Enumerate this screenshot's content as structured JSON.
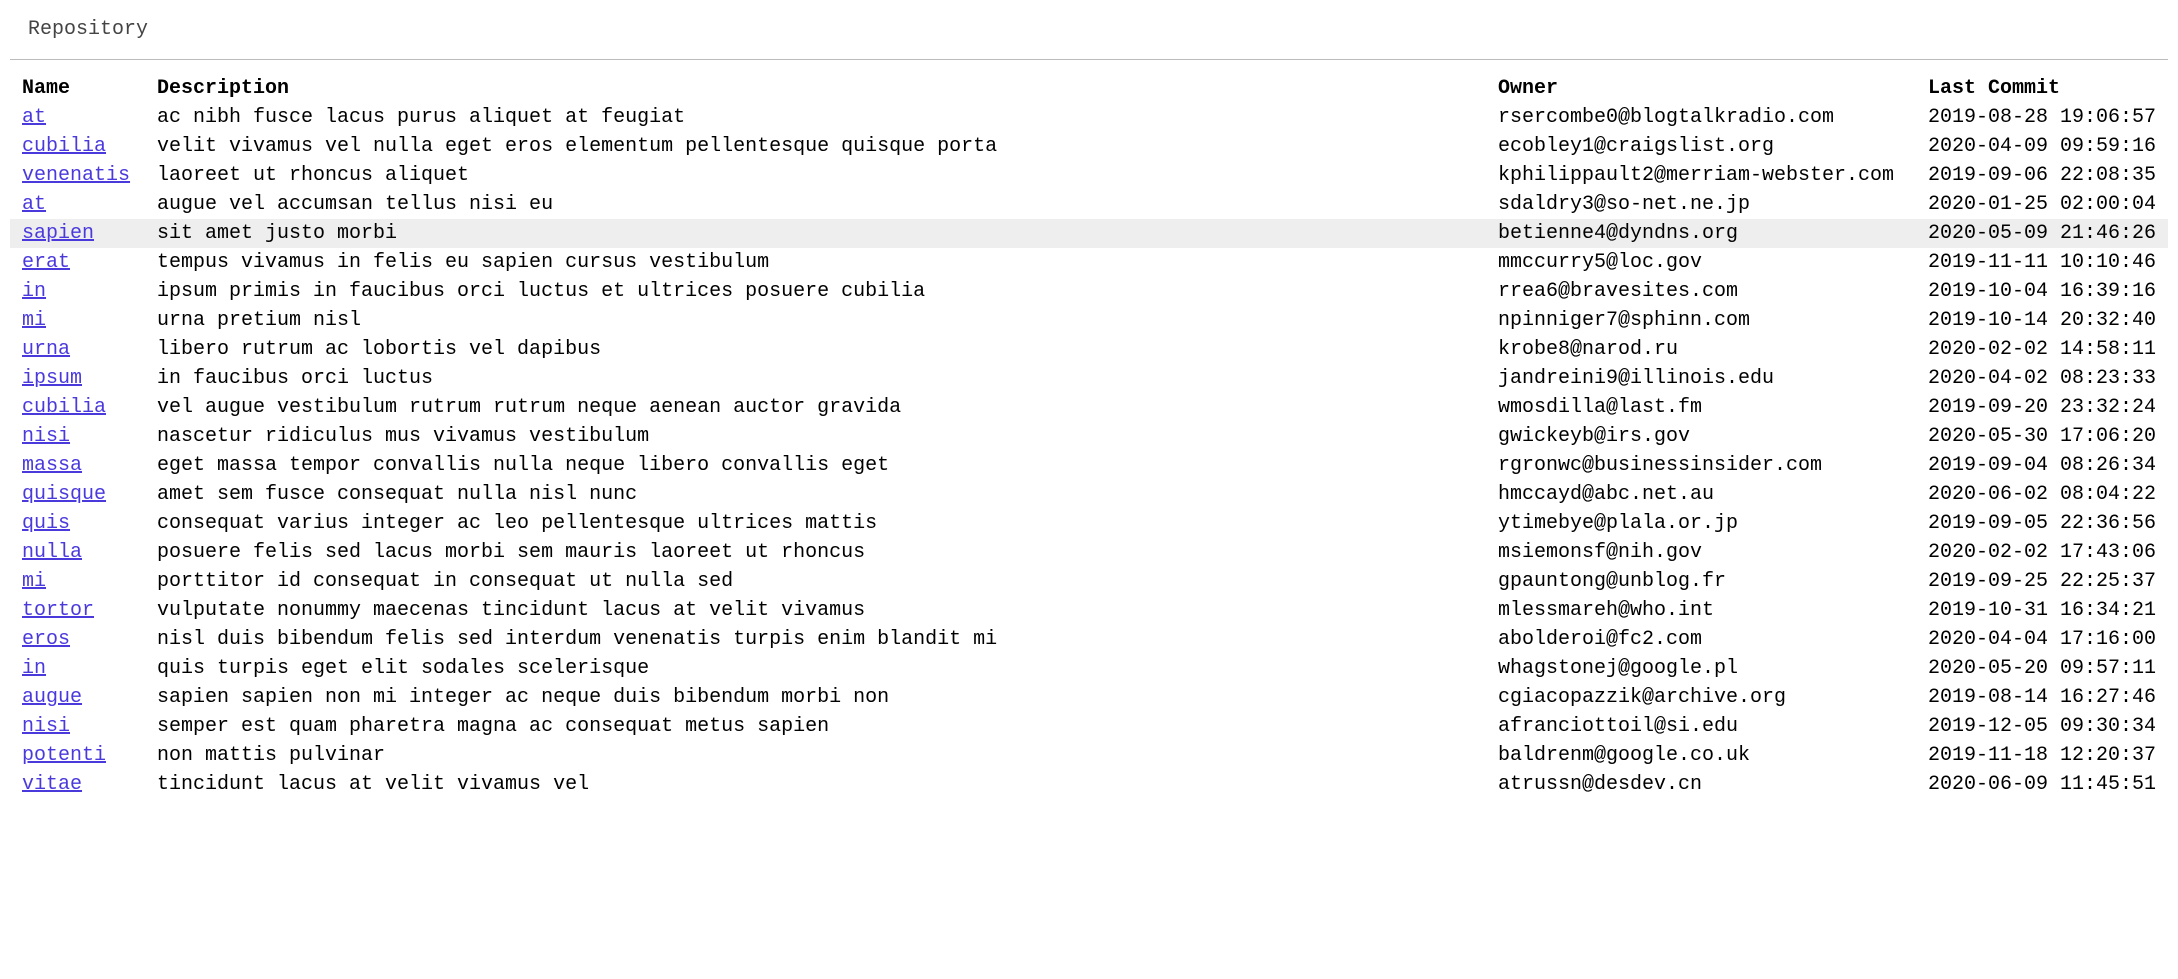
{
  "page_title": "Repository",
  "columns": {
    "name": "Name",
    "description": "Description",
    "owner": "Owner",
    "last_commit": "Last Commit"
  },
  "hovered_row_index": 4,
  "rows": [
    {
      "name": "at",
      "description": "ac nibh fusce lacus purus aliquet at feugiat",
      "owner": "rsercombe0@blogtalkradio.com",
      "last_commit": "2019-08-28 19:06:57"
    },
    {
      "name": "cubilia",
      "description": "velit vivamus vel nulla eget eros elementum pellentesque quisque porta",
      "owner": "ecobley1@craigslist.org",
      "last_commit": "2020-04-09 09:59:16"
    },
    {
      "name": "venenatis",
      "description": "laoreet ut rhoncus aliquet",
      "owner": "kphilippault2@merriam-webster.com",
      "last_commit": "2019-09-06 22:08:35"
    },
    {
      "name": "at",
      "description": "augue vel accumsan tellus nisi eu",
      "owner": "sdaldry3@so-net.ne.jp",
      "last_commit": "2020-01-25 02:00:04"
    },
    {
      "name": "sapien",
      "description": "sit amet justo morbi",
      "owner": "betienne4@dyndns.org",
      "last_commit": "2020-05-09 21:46:26"
    },
    {
      "name": "erat",
      "description": "tempus vivamus in felis eu sapien cursus vestibulum",
      "owner": "mmccurry5@loc.gov",
      "last_commit": "2019-11-11 10:10:46"
    },
    {
      "name": "in",
      "description": "ipsum primis in faucibus orci luctus et ultrices posuere cubilia",
      "owner": "rrea6@bravesites.com",
      "last_commit": "2019-10-04 16:39:16"
    },
    {
      "name": "mi",
      "description": "urna pretium nisl",
      "owner": "npinniger7@sphinn.com",
      "last_commit": "2019-10-14 20:32:40"
    },
    {
      "name": "urna",
      "description": "libero rutrum ac lobortis vel dapibus",
      "owner": "krobe8@narod.ru",
      "last_commit": "2020-02-02 14:58:11"
    },
    {
      "name": "ipsum",
      "description": "in faucibus orci luctus",
      "owner": "jandreini9@illinois.edu",
      "last_commit": "2020-04-02 08:23:33"
    },
    {
      "name": "cubilia",
      "description": "vel augue vestibulum rutrum rutrum neque aenean auctor gravida",
      "owner": "wmosdilla@last.fm",
      "last_commit": "2019-09-20 23:32:24"
    },
    {
      "name": "nisi",
      "description": "nascetur ridiculus mus vivamus vestibulum",
      "owner": "gwickeyb@irs.gov",
      "last_commit": "2020-05-30 17:06:20"
    },
    {
      "name": "massa",
      "description": "eget massa tempor convallis nulla neque libero convallis eget",
      "owner": "rgronwc@businessinsider.com",
      "last_commit": "2019-09-04 08:26:34"
    },
    {
      "name": "quisque",
      "description": "amet sem fusce consequat nulla nisl nunc",
      "owner": "hmccayd@abc.net.au",
      "last_commit": "2020-06-02 08:04:22"
    },
    {
      "name": "quis",
      "description": "consequat varius integer ac leo pellentesque ultrices mattis",
      "owner": "ytimebye@plala.or.jp",
      "last_commit": "2019-09-05 22:36:56"
    },
    {
      "name": "nulla",
      "description": "posuere felis sed lacus morbi sem mauris laoreet ut rhoncus",
      "owner": "msiemonsf@nih.gov",
      "last_commit": "2020-02-02 17:43:06"
    },
    {
      "name": "mi",
      "description": "porttitor id consequat in consequat ut nulla sed",
      "owner": "gpauntong@unblog.fr",
      "last_commit": "2019-09-25 22:25:37"
    },
    {
      "name": "tortor",
      "description": "vulputate nonummy maecenas tincidunt lacus at velit vivamus",
      "owner": "mlessmareh@who.int",
      "last_commit": "2019-10-31 16:34:21"
    },
    {
      "name": "eros",
      "description": "nisl duis bibendum felis sed interdum venenatis turpis enim blandit mi",
      "owner": "abolderoi@fc2.com",
      "last_commit": "2020-04-04 17:16:00"
    },
    {
      "name": "in",
      "description": "quis turpis eget elit sodales scelerisque",
      "owner": "whagstonej@google.pl",
      "last_commit": "2020-05-20 09:57:11"
    },
    {
      "name": "augue",
      "description": "sapien sapien non mi integer ac neque duis bibendum morbi non",
      "owner": "cgiacopazzik@archive.org",
      "last_commit": "2019-08-14 16:27:46"
    },
    {
      "name": "nisi",
      "description": "semper est quam pharetra magna ac consequat metus sapien",
      "owner": "afranciottoil@si.edu",
      "last_commit": "2019-12-05 09:30:34"
    },
    {
      "name": "potenti",
      "description": "non mattis pulvinar",
      "owner": "baldrenm@google.co.uk",
      "last_commit": "2019-11-18 12:20:37"
    },
    {
      "name": "vitae",
      "description": "tincidunt lacus at velit vivamus vel",
      "owner": "atrussn@desdev.cn",
      "last_commit": "2020-06-09 11:45:51"
    }
  ]
}
